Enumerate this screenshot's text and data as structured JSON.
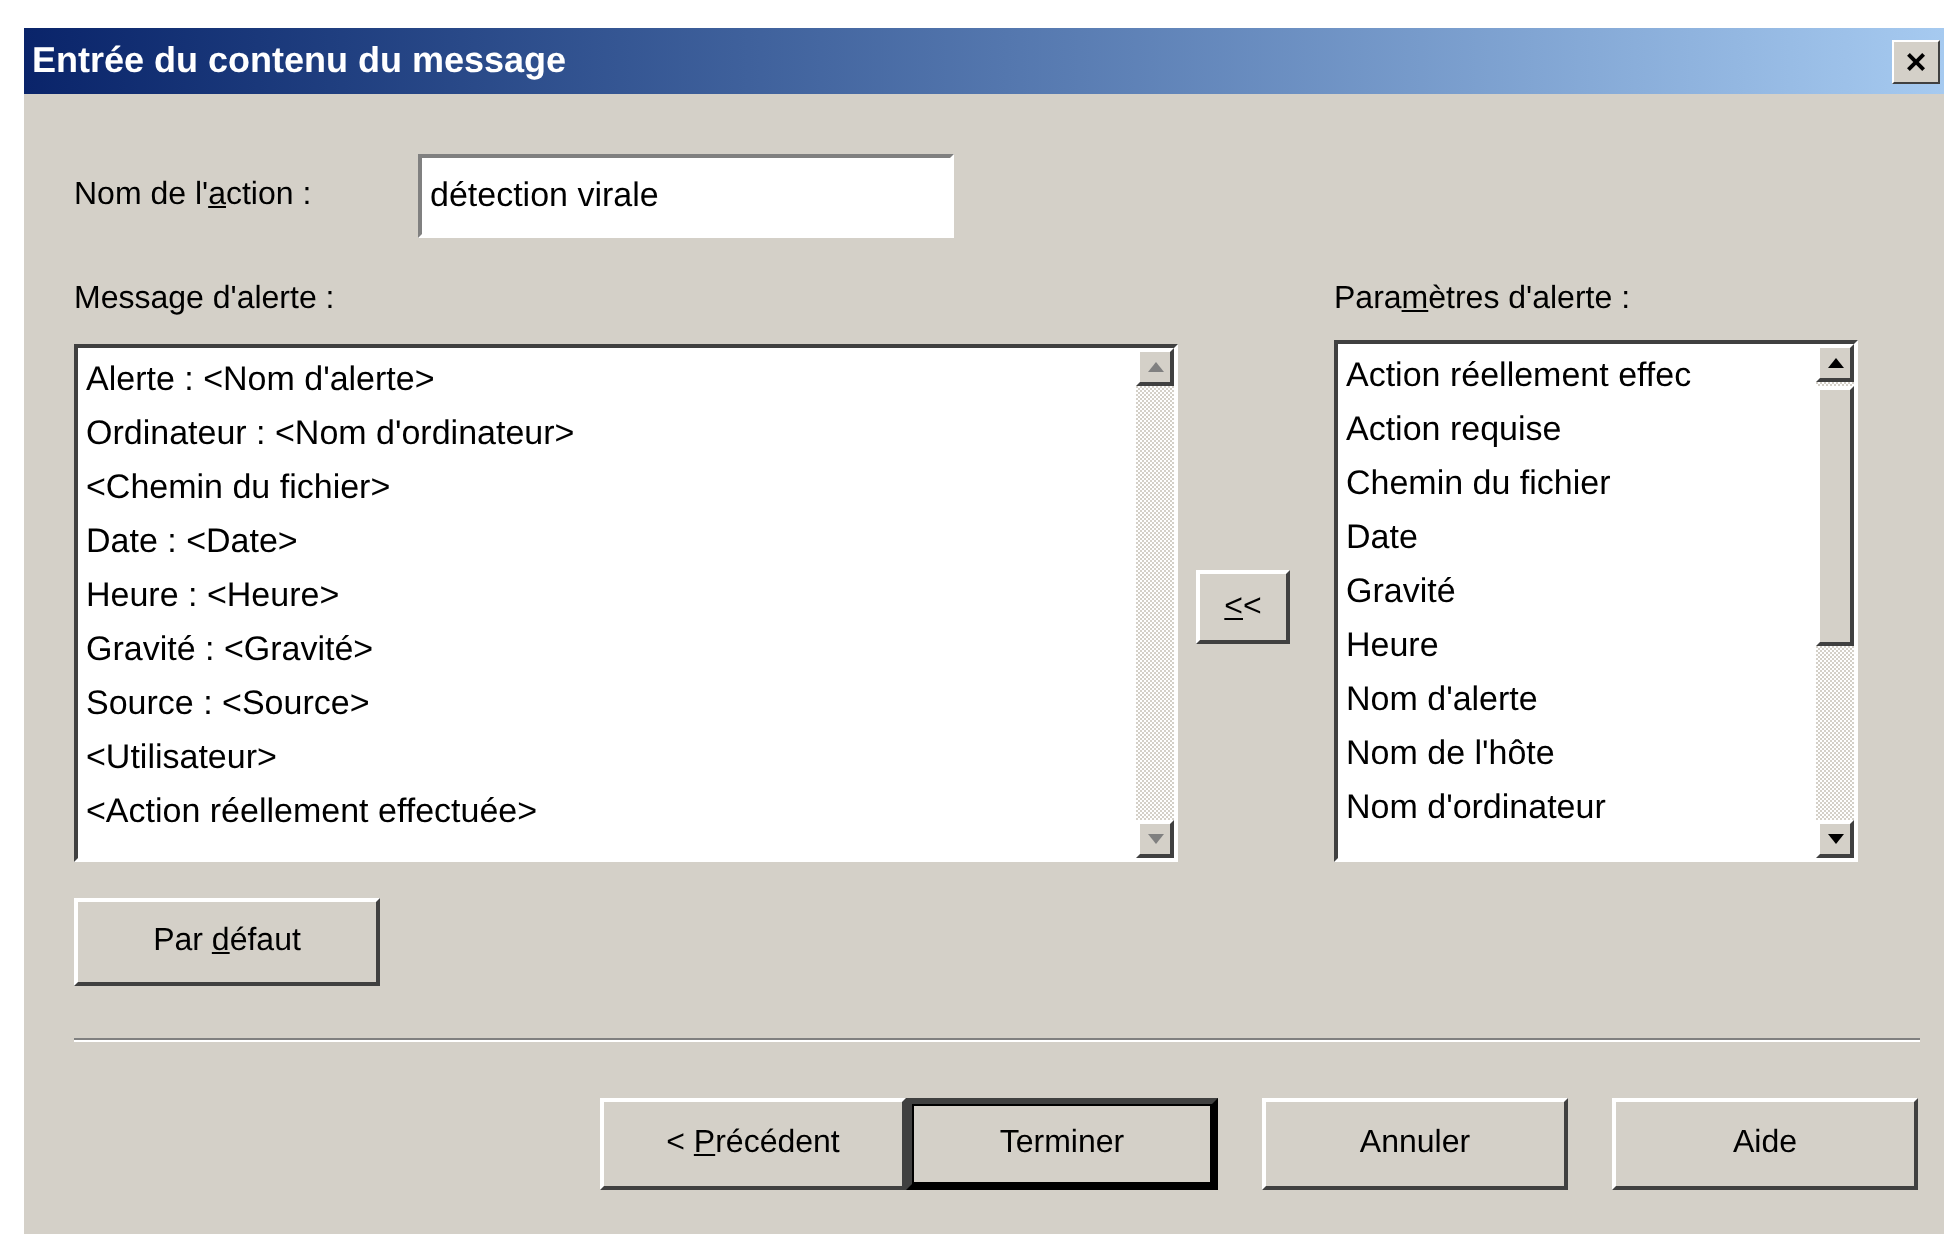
{
  "window": {
    "title": "Entrée du contenu du message",
    "close": "×"
  },
  "action_name": {
    "label": {
      "text": "Nom de l'",
      "mnemonic": "a",
      "after": "ction :"
    },
    "value": "détection virale"
  },
  "message": {
    "label": {
      "text": "Message d'alerte :"
    },
    "scrollbar_disabled": true,
    "lines": [
      "Alerte : <Nom d'alerte>",
      "Ordinateur : <Nom d'ordinateur>",
      "<Chemin du fichier>",
      "Date : <Date>",
      "Heure : <Heure>",
      "Gravité : <Gravité>",
      "Source : <Source>",
      "<Utilisateur>",
      "<Action réellement effectuée>"
    ]
  },
  "insert_button": {
    "label": {
      "mnemonic": "<",
      "after": "<"
    }
  },
  "parameters": {
    "label": {
      "text": "Para",
      "mnemonic": "m",
      "after": "ètres d'alerte :"
    },
    "scrollbar_disabled": false,
    "items": [
      "Action réellement effec",
      "Action requise",
      "Chemin du fichier",
      "Date",
      "Gravité",
      "Heure",
      "Nom d'alerte",
      "Nom de l'hôte",
      "Nom d'ordinateur"
    ]
  },
  "default_button": {
    "label": {
      "text": "Par ",
      "mnemonic": "d",
      "after": "éfaut"
    }
  },
  "buttons": [
    {
      "label": {
        "text": "< ",
        "mnemonic": "P",
        "after": "récédent"
      },
      "default": false
    },
    {
      "label": {
        "text": "Terminer"
      },
      "default": true
    },
    {
      "label": {
        "text": "Annuler"
      },
      "default": false
    },
    {
      "label": {
        "text": "Aide"
      },
      "default": false
    }
  ]
}
